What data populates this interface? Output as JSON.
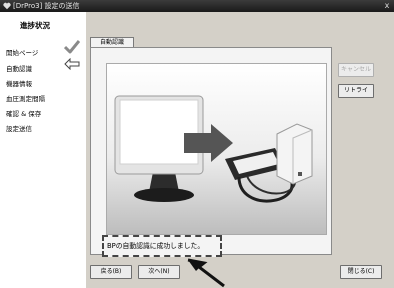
{
  "window": {
    "title": "[DrPro3] 設定の送信",
    "close_label": "x"
  },
  "sidebar": {
    "heading": "進捗状況",
    "steps": [
      {
        "label": "開始ページ",
        "status": "done"
      },
      {
        "label": "自動認識",
        "status": "current"
      },
      {
        "label": "機器情報",
        "status": "pending"
      },
      {
        "label": "血圧測定間隔",
        "status": "pending"
      },
      {
        "label": "確認 & 保存",
        "status": "pending"
      },
      {
        "label": "設定送信",
        "status": "pending"
      }
    ]
  },
  "tab": {
    "label": "自動認識"
  },
  "side_buttons": {
    "cancel": "キャンセル",
    "retry": "リトライ"
  },
  "status_message": "BPの自動認識に成功しました。",
  "footer": {
    "back": "戻る(B)",
    "next": "次へ(N)",
    "close": "閉じる(C)"
  },
  "colors": {
    "check": "#8a8a8a",
    "accent_dark": "#1a1a1a"
  }
}
